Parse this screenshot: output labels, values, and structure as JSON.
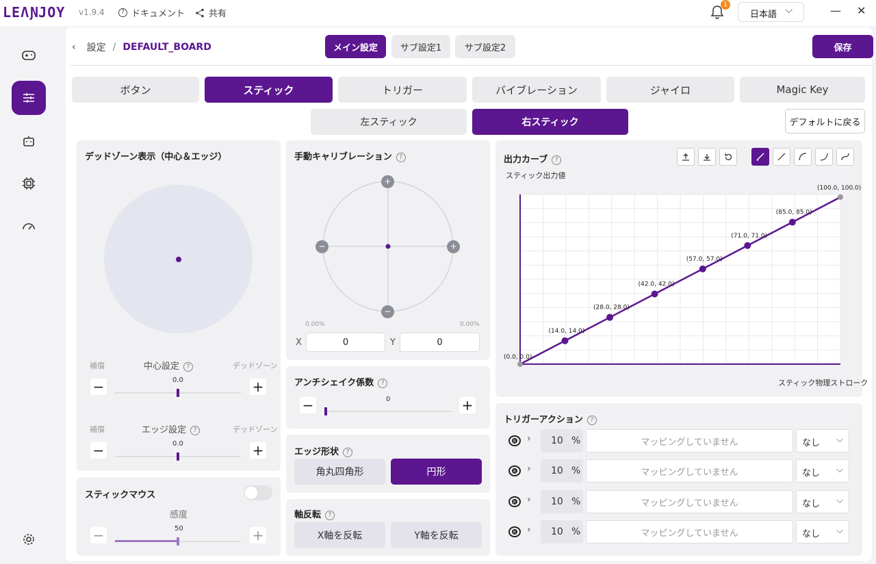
{
  "app": {
    "logo": "LEΛƝJOY",
    "version": "v1.9.4",
    "docs": "ドキュメント",
    "share": "共有",
    "notif_count": "1",
    "language": "日本語"
  },
  "breadcrumb": {
    "settings": "設定",
    "board": "DEFAULT_BOARD"
  },
  "profiles": [
    "メイン設定",
    "サブ設定1",
    "サブ設定2"
  ],
  "save_label": "保存",
  "tabs": [
    "ボタン",
    "スティック",
    "トリガー",
    "バイブレーション",
    "ジャイロ",
    "Magic Key"
  ],
  "subtabs": [
    "左スティック",
    "右スティック"
  ],
  "reset_label": "デフォルトに戻る",
  "deadzone": {
    "title": "デッドゾーン表示（中心＆エッジ）",
    "center": {
      "label": "中心設定",
      "left": "補償",
      "right": "デッドゾーン",
      "value": "0.0"
    },
    "edge": {
      "label": "エッジ設定",
      "left": "補償",
      "right": "デッドゾーン",
      "value": "0.0"
    }
  },
  "stickmouse": {
    "title": "スティックマウス",
    "sens_label": "感度",
    "value": "50",
    "sens_fraction": 0.5,
    "enabled": false
  },
  "calibration": {
    "title": "手動キャリブレーション",
    "pct_left": "0.00%",
    "pct_right": "0.00%",
    "x_label": "X",
    "x_value": "0",
    "y_label": "Y",
    "y_value": "0"
  },
  "antishake": {
    "title": "アンチシェイク係数",
    "value": "0"
  },
  "edge_shape": {
    "title": "エッジ形状",
    "options": [
      "角丸四角形",
      "円形"
    ],
    "selected": "円形"
  },
  "axis_invert": {
    "title": "軸反転",
    "options": [
      "X軸を反転",
      "Y軸を反転"
    ]
  },
  "curve": {
    "title": "出力カーブ",
    "ylabel": "スティック出力値",
    "xlabel": "スティック物理ストローク",
    "points": [
      [
        0,
        0
      ],
      [
        14,
        14
      ],
      [
        28,
        28
      ],
      [
        42,
        42
      ],
      [
        57,
        57
      ],
      [
        71,
        71
      ],
      [
        85,
        85
      ],
      [
        100,
        100
      ]
    ],
    "labels": [
      "(0.0, 0.0)",
      "(14.0, 14.0)",
      "(28.0, 28.0)",
      "(42.0, 42.0)",
      "(57.0, 57.0)",
      "(71.0, 71.0)",
      "(85.0, 85.0)",
      "(100.0, 100.0)"
    ],
    "color": "#5b1690"
  },
  "trigger_action": {
    "title": "トリガーアクション",
    "rows": [
      {
        "value": "10",
        "unit": "%",
        "mapping": "マッピングしていません",
        "select": "なし"
      },
      {
        "value": "10",
        "unit": "%",
        "mapping": "マッピングしていません",
        "select": "なし"
      },
      {
        "value": "10",
        "unit": "%",
        "mapping": "マッピングしていません",
        "select": "なし"
      },
      {
        "value": "10",
        "unit": "%",
        "mapping": "マッピングしていません",
        "select": "なし"
      }
    ]
  }
}
